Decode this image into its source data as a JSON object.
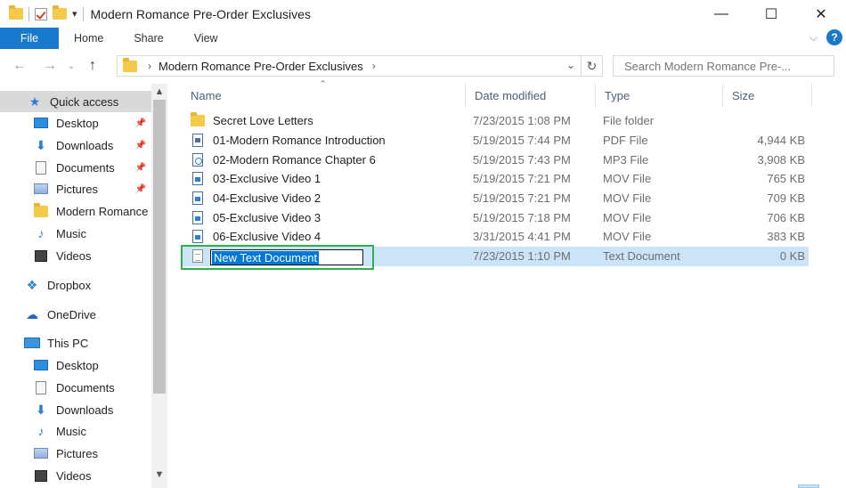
{
  "window": {
    "title": "Modern Romance Pre-Order Exclusives",
    "controls": {
      "minimize": "—",
      "maximize": "☐",
      "close": "✕"
    }
  },
  "ribbon": {
    "tabs": [
      "File",
      "Home",
      "Share",
      "View"
    ],
    "help": "?"
  },
  "address": {
    "path": "Modern Romance Pre-Order Exclusives",
    "search_placeholder": "Search Modern Romance Pre-..."
  },
  "sidebar": {
    "items": [
      {
        "label": "Quick access",
        "icon": "star-icon",
        "selected": true
      },
      {
        "label": "Desktop",
        "icon": "desktop-icon",
        "pinned": true
      },
      {
        "label": "Downloads",
        "icon": "download-icon",
        "pinned": true
      },
      {
        "label": "Documents",
        "icon": "documents-icon",
        "pinned": true
      },
      {
        "label": "Pictures",
        "icon": "pictures-icon",
        "pinned": true
      },
      {
        "label": "Modern Romance",
        "icon": "folder-icon"
      },
      {
        "label": "Music",
        "icon": "music-icon"
      },
      {
        "label": "Videos",
        "icon": "videos-icon"
      },
      {
        "label": "Dropbox",
        "icon": "dropbox-icon"
      },
      {
        "label": "OneDrive",
        "icon": "onedrive-icon"
      },
      {
        "label": "This PC",
        "icon": "pc-icon"
      },
      {
        "label": "Desktop",
        "icon": "desktop-icon"
      },
      {
        "label": "Documents",
        "icon": "documents-icon"
      },
      {
        "label": "Downloads",
        "icon": "download-icon"
      },
      {
        "label": "Music",
        "icon": "music-icon"
      },
      {
        "label": "Pictures",
        "icon": "pictures-icon"
      },
      {
        "label": "Videos",
        "icon": "videos-icon"
      }
    ]
  },
  "columns": {
    "name": "Name",
    "date": "Date modified",
    "type": "Type",
    "size": "Size"
  },
  "files": [
    {
      "name": "Secret Love Letters",
      "date": "7/23/2015 1:08 PM",
      "type": "File folder",
      "size": "",
      "icon": "folder-icon"
    },
    {
      "name": "01-Modern Romance Introduction",
      "date": "5/19/2015 7:44 PM",
      "type": "PDF File",
      "size": "4,944 KB",
      "icon": "pdf-file-icon"
    },
    {
      "name": "02-Modern Romance Chapter 6",
      "date": "5/19/2015 7:43 PM",
      "type": "MP3 File",
      "size": "3,908 KB",
      "icon": "mp3-file-icon"
    },
    {
      "name": "03-Exclusive Video 1",
      "date": "5/19/2015 7:21 PM",
      "type": "MOV File",
      "size": "765 KB",
      "icon": "mov-file-icon"
    },
    {
      "name": "04-Exclusive Video 2",
      "date": "5/19/2015 7:21 PM",
      "type": "MOV File",
      "size": "709 KB",
      "icon": "mov-file-icon"
    },
    {
      "name": "05-Exclusive Video 3",
      "date": "5/19/2015 7:18 PM",
      "type": "MOV File",
      "size": "706 KB",
      "icon": "mov-file-icon"
    },
    {
      "name": "06-Exclusive Video 4",
      "date": "3/31/2015 4:41 PM",
      "type": "MOV File",
      "size": "383 KB",
      "icon": "mov-file-icon"
    },
    {
      "name": "New Text Document",
      "date": "7/23/2015 1:10 PM",
      "type": "Text Document",
      "size": "0 KB",
      "icon": "text-file-icon",
      "selected": true,
      "renaming": true
    }
  ]
}
